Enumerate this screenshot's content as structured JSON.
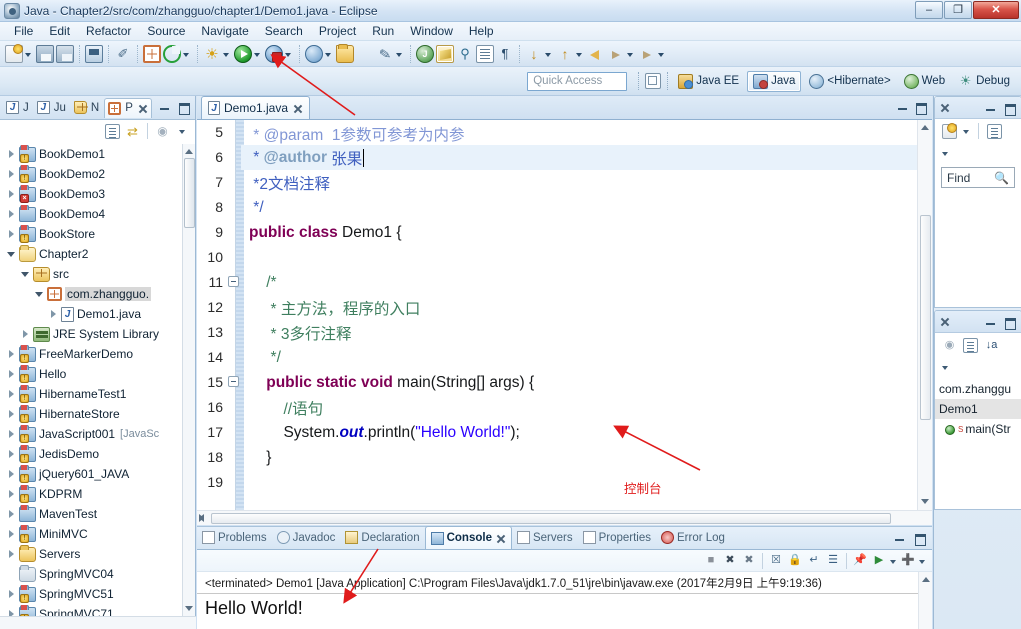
{
  "window": {
    "title": "Java - Chapter2/src/com/zhangguo/chapter1/Demo1.java - Eclipse",
    "app_icon": "eclipse-icon",
    "controls": {
      "minimize": "–",
      "maximize": "❐",
      "close": "✕"
    }
  },
  "menubar": {
    "items": [
      "File",
      "Edit",
      "Refactor",
      "Source",
      "Navigate",
      "Search",
      "Project",
      "Run",
      "Window",
      "Help"
    ]
  },
  "toolbar": {
    "groups": [
      {
        "items": [
          {
            "name": "new-wizard-icon",
            "cls": "ic-new",
            "arrow": true
          },
          {
            "name": "save-icon",
            "cls": "ic-save",
            "arrow": false
          },
          {
            "name": "save-all-icon",
            "cls": "ic-saveall",
            "arrow": false
          }
        ]
      },
      {
        "items": [
          {
            "name": "print-icon",
            "cls": "ic-print",
            "arrow": false
          }
        ]
      },
      {
        "items": [
          {
            "name": "toggle-mark-occurrences-icon",
            "cls": "ic-pen",
            "arrow": false
          }
        ]
      },
      {
        "items": [
          {
            "name": "new-java-package-icon",
            "cls": "ic-grid",
            "arrow": false
          },
          {
            "name": "new-java-class-icon",
            "cls": "ic-circ-green",
            "arrow": true
          }
        ]
      },
      {
        "items": [
          {
            "name": "external-tools-icon",
            "cls": "ic-sun",
            "arrow": true
          },
          {
            "name": "run-icon",
            "cls": "ic-run",
            "arrow": true
          },
          {
            "name": "debug-icon",
            "cls": "ic-debug",
            "arrow": true
          }
        ]
      },
      {
        "items": [
          {
            "name": "run-external-tool-icon",
            "cls": "ic-extern",
            "arrow": true
          },
          {
            "name": "open-type-icon",
            "cls": "ic-folder",
            "arrow": false
          },
          {
            "name": "open-task-icon",
            "cls": "ic-gen-folder2",
            "arrow": false
          },
          {
            "name": "search-icon",
            "cls": "ic-brush",
            "arrow": true
          }
        ]
      },
      {
        "items": [
          {
            "name": "java-perspective-icon",
            "cls": "ic-javap",
            "arrow": false
          },
          {
            "name": "editor-highlight-icon",
            "cls": "ic-persp-sel",
            "arrow": false
          },
          {
            "name": "link-editor-icon",
            "cls": "ic-search-tb",
            "arrow": false
          },
          {
            "name": "outline-toggle-icon",
            "cls": "ic-outline",
            "arrow": false
          },
          {
            "name": "show-whitespace-icon",
            "cls": "ic-pilcrow",
            "arrow": false
          }
        ]
      },
      {
        "items": [
          {
            "name": "next-annotation-icon",
            "cls": "ic-next-ann",
            "arrow": true
          },
          {
            "name": "previous-annotation-icon",
            "cls": "ic-prev-ann",
            "arrow": true
          },
          {
            "name": "back-icon",
            "cls": "ic-back",
            "arrow": false
          },
          {
            "name": "forward-icon",
            "cls": "ic-fwd",
            "arrow": true
          },
          {
            "name": "forward-nav-icon",
            "cls": "ic-fwd",
            "arrow": true
          }
        ]
      }
    ]
  },
  "perspective_bar": {
    "quick_access_placeholder": "Quick Access",
    "open_perspective_label": "",
    "perspectives": [
      {
        "label": "Java EE",
        "icon": "java-ee-perspective-icon",
        "icon_cls": "pico-javaee",
        "active": false
      },
      {
        "label": "Java",
        "icon": "java-perspective-icon",
        "icon_cls": "pico-java",
        "active": true
      },
      {
        "label": "<Hibernate>",
        "icon": "hibernate-perspective-icon",
        "icon_cls": "pico-hib",
        "active": false
      },
      {
        "label": "Web",
        "icon": "web-perspective-icon",
        "icon_cls": "pico-web",
        "active": false
      },
      {
        "label": "Debug",
        "icon": "debug-perspective-icon",
        "icon_cls": "pico-debug",
        "active": false
      }
    ]
  },
  "package_explorer": {
    "tabs": [
      {
        "label": "P",
        "icon": "package-explorer-icon",
        "active": true
      },
      {
        "label": "N",
        "icon": "navigator-icon",
        "active": false
      },
      {
        "label": "Ju",
        "icon": "junit-icon",
        "active": false
      },
      {
        "label": "J",
        "icon": "junit2-icon",
        "active": false
      }
    ],
    "tree": [
      {
        "label": "BookDemo1",
        "icon": "java-project-icon",
        "badge": "warn",
        "expander": "closed",
        "indent": 0
      },
      {
        "label": "BookDemo2",
        "icon": "java-project-icon",
        "badge": "warn",
        "expander": "closed",
        "indent": 0
      },
      {
        "label": "BookDemo3",
        "icon": "java-project-icon",
        "badge": "error",
        "expander": "closed",
        "indent": 0
      },
      {
        "label": "BookDemo4",
        "icon": "java-project-icon",
        "badge": "none",
        "expander": "closed",
        "indent": 0
      },
      {
        "label": "BookStore",
        "icon": "java-project-icon",
        "badge": "warn",
        "expander": "closed",
        "indent": 0
      },
      {
        "label": "Chapter2",
        "icon": "open-project-icon",
        "badge": "none",
        "expander": "open",
        "indent": 0
      },
      {
        "label": "src",
        "icon": "source-folder-icon",
        "badge": "none",
        "expander": "open",
        "indent": 1
      },
      {
        "label": "com.zhangguo.",
        "icon": "package-icon",
        "badge": "none",
        "expander": "open",
        "indent": 2,
        "selected": true
      },
      {
        "label": "Demo1.java",
        "icon": "java-file-icon",
        "badge": "none",
        "expander": "closed",
        "indent": 3
      },
      {
        "label": "JRE System Library",
        "icon": "jre-library-icon",
        "badge": "none",
        "expander": "closed",
        "indent": 1
      },
      {
        "label": "FreeMarkerDemo",
        "icon": "java-project-icon",
        "badge": "warn",
        "expander": "closed",
        "indent": 0
      },
      {
        "label": "Hello",
        "icon": "java-project-icon",
        "badge": "warn",
        "expander": "closed",
        "indent": 0
      },
      {
        "label": "HibernameTest1",
        "icon": "java-project-icon",
        "badge": "warn",
        "expander": "closed",
        "indent": 0
      },
      {
        "label": "HibernateStore",
        "icon": "java-project-icon",
        "badge": "warn",
        "expander": "closed",
        "indent": 0
      },
      {
        "label": "JavaScript001",
        "suffix": "[JavaSc",
        "icon": "web-project-icon",
        "badge": "warn",
        "expander": "closed",
        "indent": 0
      },
      {
        "label": "JedisDemo",
        "icon": "java-project-icon",
        "badge": "warn",
        "expander": "closed",
        "indent": 0
      },
      {
        "label": "jQuery601_JAVA",
        "icon": "web-project-icon",
        "badge": "warn",
        "expander": "closed",
        "indent": 0
      },
      {
        "label": "KDPRM",
        "icon": "java-project-icon",
        "badge": "warn",
        "expander": "closed",
        "indent": 0
      },
      {
        "label": "MavenTest",
        "icon": "java-project-icon",
        "badge": "none",
        "expander": "closed",
        "indent": 0
      },
      {
        "label": "MiniMVC",
        "icon": "java-project-icon",
        "badge": "warn",
        "expander": "closed",
        "indent": 0
      },
      {
        "label": "Servers",
        "icon": "folder-icon",
        "badge": "none",
        "expander": "closed",
        "indent": 0
      },
      {
        "label": "SpringMVC04",
        "icon": "closed-project-icon",
        "badge": "none",
        "expander": "none",
        "indent": 0
      },
      {
        "label": "SpringMVC51",
        "icon": "java-project-icon",
        "badge": "warn",
        "expander": "closed",
        "indent": 0
      },
      {
        "label": "SpringMVC71",
        "icon": "java-project-icon",
        "badge": "warn",
        "expander": "closed",
        "indent": 0
      }
    ]
  },
  "editor": {
    "tab": {
      "label": "Demo1.java",
      "icon": "java-file-icon",
      "close": "✕"
    },
    "lines": [
      {
        "num": "5",
        "fold": false,
        "highlight": false,
        "clipped": true,
        "segments": [
          {
            "t": " * @param  1参数可参考为内参",
            "c": "jdoc"
          }
        ]
      },
      {
        "num": "6",
        "fold": false,
        "highlight": true,
        "caret": true,
        "segments": [
          {
            "t": " * ",
            "c": "jdoc"
          },
          {
            "t": "@author",
            "c": "jdoc-tag"
          },
          {
            "t": " 张果",
            "c": "jdoc"
          }
        ]
      },
      {
        "num": "7",
        "fold": false,
        "highlight": false,
        "segments": [
          {
            "t": " *2文档注释",
            "c": "jdoc"
          }
        ]
      },
      {
        "num": "8",
        "fold": false,
        "highlight": false,
        "segments": [
          {
            "t": " */",
            "c": "jdoc"
          }
        ]
      },
      {
        "num": "9",
        "fold": false,
        "highlight": false,
        "segments": [
          {
            "t": "public class ",
            "c": "kw"
          },
          {
            "t": "Demo1 {",
            "c": ""
          }
        ]
      },
      {
        "num": "10",
        "fold": false,
        "highlight": false,
        "segments": []
      },
      {
        "num": "11",
        "fold": true,
        "highlight": false,
        "segments": [
          {
            "t": "    /*",
            "c": "cmt"
          }
        ]
      },
      {
        "num": "12",
        "fold": false,
        "highlight": false,
        "segments": [
          {
            "t": "     * 主方法，程序的入口",
            "c": "cmt"
          }
        ]
      },
      {
        "num": "13",
        "fold": false,
        "highlight": false,
        "segments": [
          {
            "t": "     * 3多行注释",
            "c": "cmt"
          }
        ]
      },
      {
        "num": "14",
        "fold": false,
        "highlight": false,
        "segments": [
          {
            "t": "     */",
            "c": "cmt"
          }
        ]
      },
      {
        "num": "15",
        "fold": true,
        "highlight": false,
        "segments": [
          {
            "t": "    ",
            "c": ""
          },
          {
            "t": "public static void ",
            "c": "kw"
          },
          {
            "t": "main(String[] args) {",
            "c": ""
          }
        ]
      },
      {
        "num": "16",
        "fold": false,
        "highlight": false,
        "segments": [
          {
            "t": "        //语句",
            "c": "cmt"
          }
        ]
      },
      {
        "num": "17",
        "fold": false,
        "highlight": false,
        "segments": [
          {
            "t": "        System.",
            "c": ""
          },
          {
            "t": "out",
            "c": "fld"
          },
          {
            "t": ".println(",
            "c": ""
          },
          {
            "t": "\"Hello World!\"",
            "c": "str"
          },
          {
            "t": ");",
            "c": ""
          }
        ]
      },
      {
        "num": "18",
        "fold": false,
        "highlight": false,
        "segments": [
          {
            "t": "    }",
            "c": ""
          }
        ]
      },
      {
        "num": "19",
        "fold": false,
        "highlight": false,
        "segments": []
      }
    ]
  },
  "console": {
    "tabs": [
      {
        "label": "Problems",
        "icon": "problems-icon",
        "active": false
      },
      {
        "label": "Javadoc",
        "icon": "javadoc-icon",
        "active": false
      },
      {
        "label": "Declaration",
        "icon": "declaration-icon",
        "active": false
      },
      {
        "label": "Console",
        "icon": "console-icon",
        "active": true,
        "close": "✕"
      },
      {
        "label": "Servers",
        "icon": "servers-icon",
        "active": false
      },
      {
        "label": "Properties",
        "icon": "properties-icon",
        "active": false
      },
      {
        "label": "Error Log",
        "icon": "error-log-icon",
        "active": false
      }
    ],
    "toolbar_icons": [
      "terminate-icon",
      "remove-launch-icon",
      "remove-all-terminated-icon",
      "clear-console-icon",
      "scroll-lock-icon",
      "word-wrap-icon",
      "show-console-icon",
      "pin-console-icon",
      "display-selected-console-icon",
      "open-console-icon"
    ],
    "terminated_line": "<terminated> Demo1 [Java Application] C:\\Program Files\\Java\\jdk1.7.0_51\\jre\\bin\\javaw.exe (2017年2月9日 上午9:19:36)",
    "output": "Hello World!"
  },
  "right_panels": {
    "search_panel": {
      "find_label": "Find",
      "find_icon": "search-icon",
      "close": "✕"
    },
    "outline_panel": {
      "close": "✕",
      "items": [
        {
          "label": "com.zhanggu",
          "icon": "package-icon",
          "sup": "",
          "selected": false
        },
        {
          "label": "Demo1",
          "icon": "class-icon",
          "sup": "",
          "selected": true
        },
        {
          "label": "main(Str",
          "icon": "method-icon",
          "sup": "S",
          "selected": false
        }
      ]
    }
  },
  "annotations": {
    "console_label": "控制台",
    "color": "#e01b1b"
  }
}
